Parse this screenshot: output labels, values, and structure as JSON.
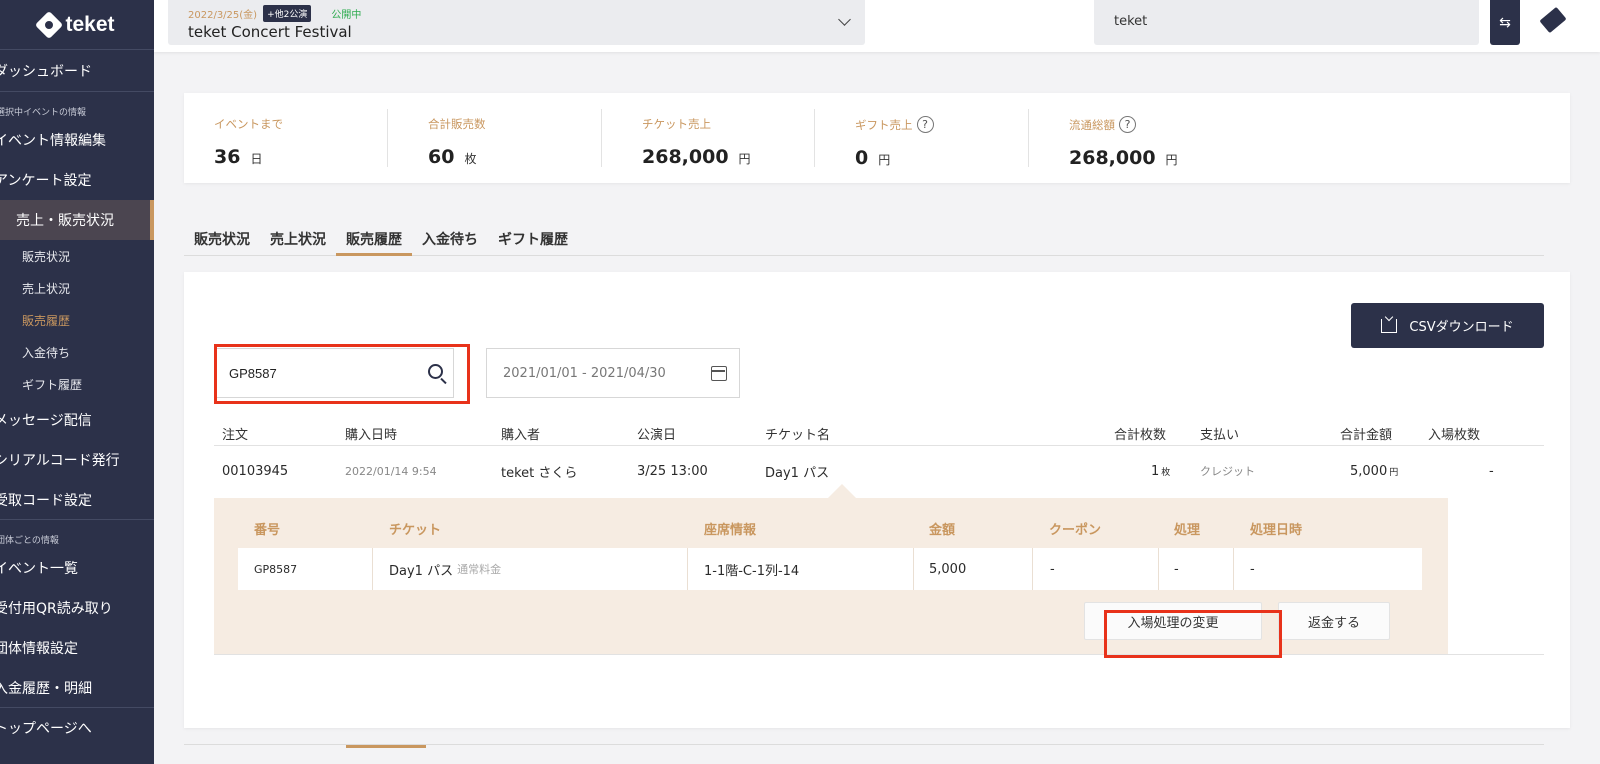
{
  "sidebar": {
    "logo": "teket",
    "dashboard": "ダッシュボード",
    "section_event": "選択中イベントの情報",
    "event_edit": "イベント情報編集",
    "survey": "アンケート設定",
    "sales": "売上・販売状況",
    "sub": [
      "販売状況",
      "売上状況",
      "販売履歴",
      "入金待ち",
      "ギフト履歴"
    ],
    "message": "メッセージ配信",
    "serial": "シリアルコード発行",
    "receive_code": "受取コード設定",
    "section_org": "団体ごとの情報",
    "event_list": "イベント一覧",
    "qr": "受付用QR読み取り",
    "org_settings": "団体情報設定",
    "payment": "入金履歴・明細",
    "top": "トップページへ"
  },
  "header": {
    "event_date": "2022/3/25(金)",
    "event_extra": "+他2公演",
    "event_status": "公開中",
    "event_name": "teket Concert Festival",
    "org_name": "teket",
    "switch_icon": "⇆"
  },
  "stats": [
    {
      "label": "イベントまで",
      "value": "36",
      "unit": "日"
    },
    {
      "label": "合計販売数",
      "value": "60",
      "unit": "枚"
    },
    {
      "label": "チケット売上",
      "value": "268,000",
      "unit": "円"
    },
    {
      "label": "ギフト売上",
      "value": "0",
      "unit": "円",
      "help": "?"
    },
    {
      "label": "流通総額",
      "value": "268,000",
      "unit": "円",
      "help": "?"
    }
  ],
  "tabs": [
    "販売状況",
    "売上状況",
    "販売履歴",
    "入金待ち",
    "ギフト履歴"
  ],
  "toolbar": {
    "csv_label": "CSVダウンロード",
    "search_value": "GP8587",
    "date_range": "2021/01/01 - 2021/04/30"
  },
  "orders": {
    "headers": [
      "注文",
      "購入日時",
      "購入者",
      "公演日",
      "チケット名",
      "合計枚数",
      "支払い",
      "合計金額",
      "入場枚数"
    ],
    "row": {
      "order": "00103945",
      "purchased": "2022/01/14 9:54",
      "buyer": "teket さくら",
      "show_date": "3/25 13:00",
      "ticket": "Day1 パス",
      "count": "1",
      "count_unit": "枚",
      "payment": "クレジット",
      "amount": "5,000",
      "amount_unit": "円",
      "entered": "-"
    }
  },
  "detail": {
    "headers": [
      "番号",
      "チケット",
      "座席情報",
      "金額",
      "クーポン",
      "処理",
      "処理日時"
    ],
    "row": {
      "number": "GP8587",
      "ticket": "Day1 パス",
      "plan": "通常料金",
      "seat": "1-1階-C-1列-14",
      "price": "5,000",
      "coupon": "-",
      "process": "-",
      "processed_at": "-"
    },
    "change_entry": "入場処理の変更",
    "refund": "返金する"
  },
  "colors": {
    "sidebar": "#2c3149",
    "accent": "#c9975f",
    "highlight": "#e8321a",
    "status_green": "#2eab4f"
  }
}
